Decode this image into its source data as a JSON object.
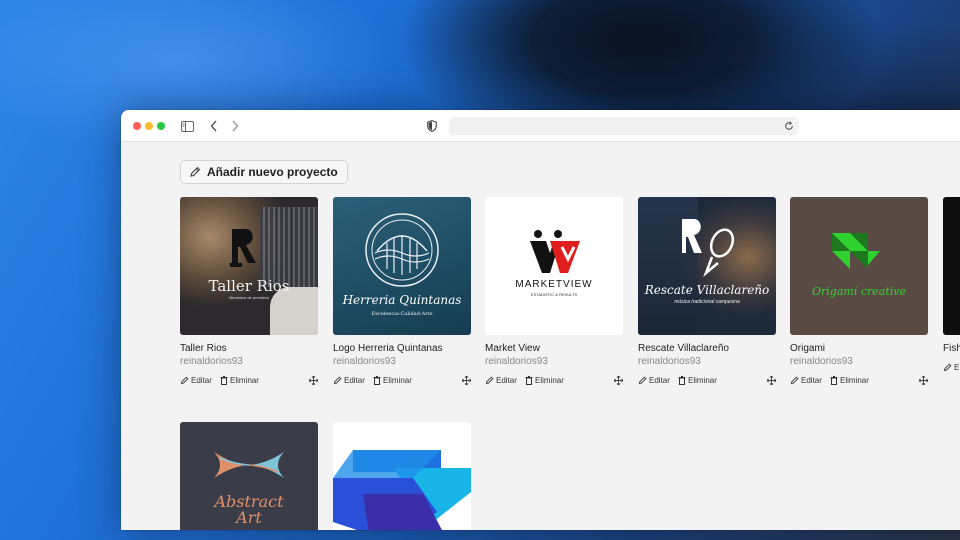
{
  "toolbar": {
    "add_project_label": "Añadir nuevo proyecto"
  },
  "projects": [
    {
      "title": "Taller Rios",
      "owner": "reinaldorios93",
      "logo_text": "Taller Rios",
      "logo_sub": "Mecánica de precisión",
      "edit": "Editar",
      "delete": "Eliminar"
    },
    {
      "title": "Logo Herreria Quintanas",
      "owner": "reinaldorios93",
      "logo_text": "Herreria Quintanas",
      "logo_sub": "Excelencia-Calidad-Arte",
      "edit": "Editar",
      "delete": "Eliminar"
    },
    {
      "title": "Market View",
      "owner": "reinaldorios93",
      "logo_text": "MARKETVIEW",
      "logo_sub": "ESTADISTIC & RESULTS",
      "edit": "Editar",
      "delete": "Eliminar"
    },
    {
      "title": "Rescate Villaclareño",
      "owner": "reinaldorios93",
      "logo_text": "Rescate Villaclareño",
      "logo_sub": "música tradicional campesina",
      "edit": "Editar",
      "delete": "Eliminar"
    },
    {
      "title": "Origami",
      "owner": "reinaldorios93",
      "logo_text": "Origami creative",
      "edit": "Editar",
      "delete": "Eliminar"
    },
    {
      "title": "Fish",
      "owner": "",
      "edit": "E"
    },
    {
      "title": "",
      "owner": "",
      "logo_text": "Abstract Art"
    },
    {
      "title": "",
      "owner": ""
    }
  ],
  "colors": {
    "window_bg": "#f3f3f3",
    "titlebar_bg": "#ffffff",
    "origami_green": "#2fd12f",
    "market_red": "#e01e1e",
    "herreria_blue": "#1f4f66"
  },
  "icons": [
    "sidebar-icon",
    "chevron-left-icon",
    "chevron-right-icon",
    "shield-icon",
    "reload-icon",
    "pencil-icon",
    "trash-icon",
    "move-icon"
  ]
}
